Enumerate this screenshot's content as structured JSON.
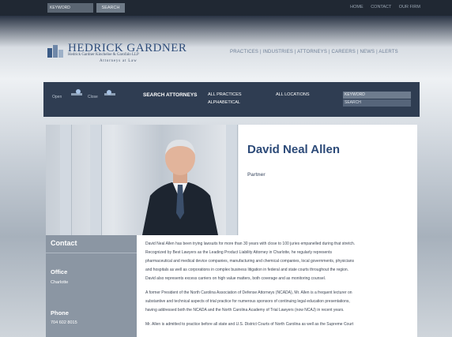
{
  "topbar": {
    "keyword_placeholder": "KEYWORD",
    "search_label": "SEARCH",
    "links": [
      "HOME",
      "CONTACT",
      "OUR FIRM"
    ]
  },
  "logo": {
    "title": "HEDRICK GARDNER",
    "subtitle": "Hedrick Gardner Kincheloe & Garofalo LLP",
    "tagline": "Attorneys at Law"
  },
  "main_nav": "PRACTICES | INDUSTRIES | ATTORNEYS | CAREERS | NEWS | ALERTS",
  "shade": {
    "open_label": "Open",
    "close_label": "Close"
  },
  "search_attorneys": {
    "label": "SEARCH ATTORNEYS",
    "all_practices": "ALL PRACTICES",
    "alphabetical": "ALPHABETICAL",
    "all_locations": "ALL LOCATIONS",
    "keyword_placeholder": "KEYWORD",
    "search_button": "SEARCH"
  },
  "profile": {
    "name": "David Neal Allen",
    "title": "Partner"
  },
  "contact": {
    "heading": "Contact",
    "office_heading": "Office",
    "office_value": "Charlotte",
    "phone_heading": "Phone",
    "phone_value": "704 602 8015"
  },
  "bio": [
    "David Neal Allen has been trying lawsuits for more than 30 years with close to 100 juries empanelled during that stretch.",
    "Recognized by Best Lawyers as the Leading Product Liability Attorney in Charlotte, he regularly represents",
    "pharmaceutical and medical device companies, manufacturing and chemical companies, local governments, physicians",
    "and hospitals as well as corporations in complex business litigation in federal and state courts throughout the region.",
    "David also represents excess carriers on high value matters, both coverage and as monitoring counsel.",
    "A former President of the North Carolina Association of Defense Attorneys (NCADA), Mr. Allen is a frequent lecturer on",
    "substantive and technical aspects of trial practice for numerous sponsors of continuing legal education presentations,",
    "having addressed both the NCADA and the North Carolina Academy of Trial Lawyers (now NCAJ) in recent years.",
    "Mr. Allen is admitted to practice before all state and U.S. District Courts of North Carolina as well as the Supreme Court"
  ],
  "colors": {
    "brand_blue": "#2c4a78",
    "search_bar": "#2f3d52",
    "contact_panel": "#8b96a3"
  }
}
